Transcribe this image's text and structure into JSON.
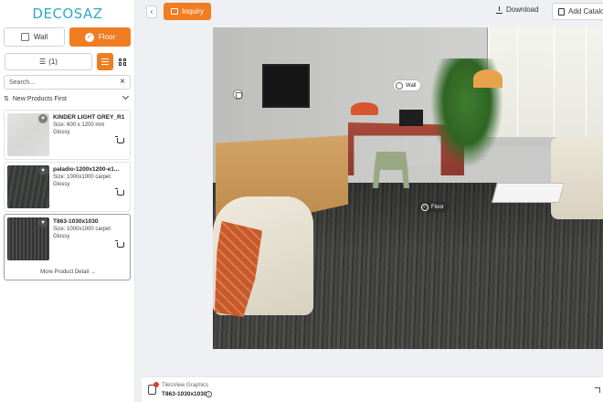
{
  "brand": "DECOSAZ",
  "surface_toggle": {
    "wall": "Wall",
    "floor": "Floor",
    "selected": "Floor"
  },
  "filter": {
    "label": "(1)",
    "icon": "filter-icon"
  },
  "view_modes": [
    "list",
    "grid"
  ],
  "search": {
    "placeholder": "Search..."
  },
  "sort": {
    "label": "New Products First"
  },
  "products": [
    {
      "name": "KINDER LIGHT GREY_R1",
      "size": "Size: 600 x 1200 mm",
      "finish": "Glossy"
    },
    {
      "name": "paladio-1200x1200-e1...",
      "size": "Size: 1000x1000 carpet",
      "finish": "Glossy"
    },
    {
      "name": "T863-1030x1030",
      "size": "Size: 1000x1000 carpet",
      "finish": "Glossy",
      "link": "More Product Detail"
    }
  ],
  "topbar": {
    "inquiry": "Inquiry",
    "download": "Download",
    "add_catalog": "Add Catalo"
  },
  "scene_tags": {
    "wall": "Wall",
    "floor": "Floor"
  },
  "bottombar": {
    "label": "TilesView Graphics",
    "product": "T863-1030x1030"
  },
  "colors": {
    "accent": "#f07d22",
    "brand": "#2fa8c7"
  }
}
